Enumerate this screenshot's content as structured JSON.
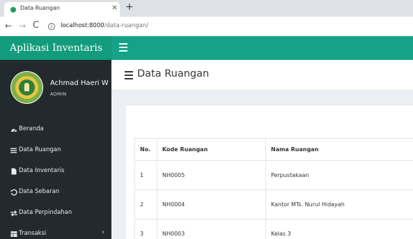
{
  "browser": {
    "tab_title": "Data Ruangan",
    "tab_close": "×",
    "new_tab": "+",
    "url_host": "localhost:8000",
    "url_path": "/data-ruangan/",
    "back": "←",
    "forward": "→",
    "reload": "C",
    "info": "i"
  },
  "app": {
    "brand": "Aplikasi Inventaris",
    "accent_color": "#16a286",
    "sidebar_color": "#232a2e"
  },
  "user": {
    "name": "Achmad Haeri W",
    "role": "ADMIN"
  },
  "sidebar": {
    "items": [
      {
        "label": "Beranda",
        "icon": "dashboard-icon"
      },
      {
        "label": "Data Ruangan",
        "icon": "list-icon"
      },
      {
        "label": "Data Inventaris",
        "icon": "file-icon"
      },
      {
        "label": "Data Sebaran",
        "icon": "history-icon"
      },
      {
        "label": "Data Perpindahan",
        "icon": "exchange-icon"
      },
      {
        "label": "Transaksi",
        "icon": "table-icon",
        "chevron": "›"
      }
    ]
  },
  "page": {
    "title": "Data Ruangan"
  },
  "table": {
    "headers": [
      "No.",
      "Kode Ruangan",
      "Nama Ruangan"
    ],
    "rows": [
      [
        "1",
        "NH0005",
        "Perpustakaan"
      ],
      [
        "2",
        "NH0004",
        "Kantor MTs. Nurul Hidayah"
      ],
      [
        "3",
        "NH0003",
        "Kelas 3"
      ]
    ]
  }
}
